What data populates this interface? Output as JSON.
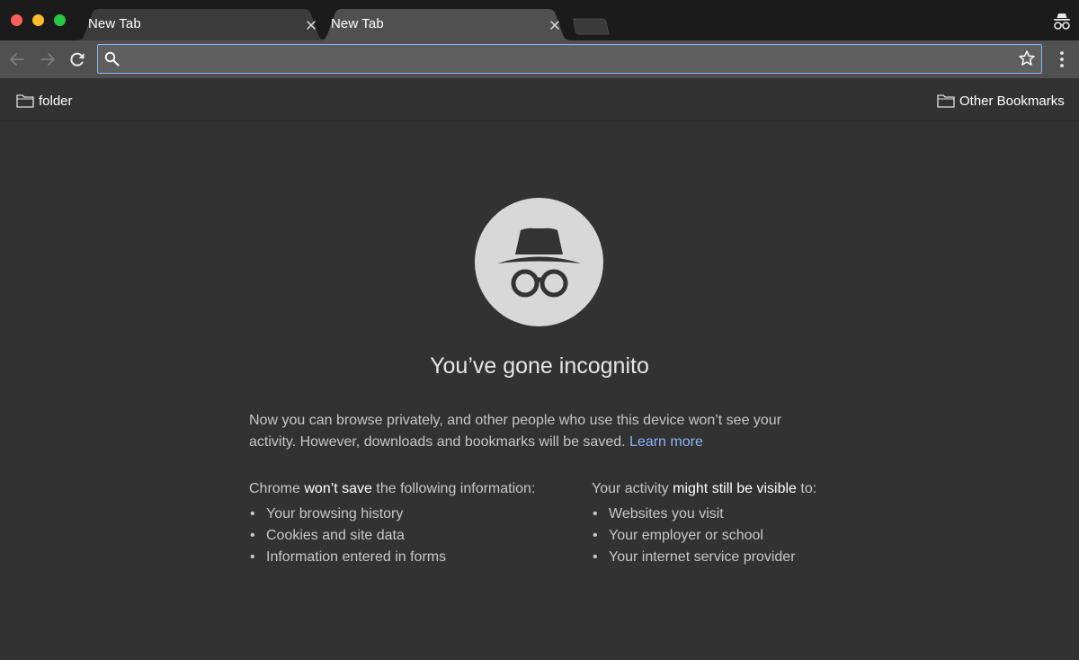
{
  "window": {
    "controls": [
      "close",
      "minimize",
      "maximize"
    ],
    "incognito_icon": "incognito-icon"
  },
  "tabs": [
    {
      "label": "New Tab",
      "active": false,
      "close_icon": "close-icon"
    },
    {
      "label": "New Tab",
      "active": true,
      "close_icon": "close-icon"
    }
  ],
  "toolbar": {
    "back_icon": "arrow-left-icon",
    "forward_icon": "arrow-right-icon",
    "reload_icon": "reload-icon",
    "search_icon": "search-icon",
    "address_value": "",
    "bookmark_star_icon": "star-icon",
    "menu_icon": "vertical-dots-icon"
  },
  "bookmarks_bar": {
    "left_item": {
      "label": "folder",
      "icon": "folder-icon"
    },
    "right_item": {
      "label": "Other Bookmarks",
      "icon": "folder-icon"
    }
  },
  "incognito_page": {
    "icon": "incognito-icon",
    "headline": "You’ve gone incognito",
    "intro_text": "Now you can browse privately, and other people who use this device won’t see your activity. However, downloads and bookmarks will be saved.",
    "learn_more": "Learn more",
    "wont_save": {
      "prefix": "Chrome ",
      "emphasis": "won’t save",
      "suffix": " the following information:",
      "items": [
        "Your browsing history",
        "Cookies and site data",
        "Information entered in forms"
      ]
    },
    "visible_to": {
      "prefix": "Your activity ",
      "emphasis": "might still be visible",
      "suffix": " to:",
      "items": [
        "Websites you visit",
        "Your employer or school",
        "Your internet service provider"
      ]
    }
  },
  "colors": {
    "titlebar": "#1b1b1c",
    "toolbar": "#505050",
    "page_background": "#323232",
    "link": "#8ab4f8",
    "badge": "#d8d8d8"
  }
}
